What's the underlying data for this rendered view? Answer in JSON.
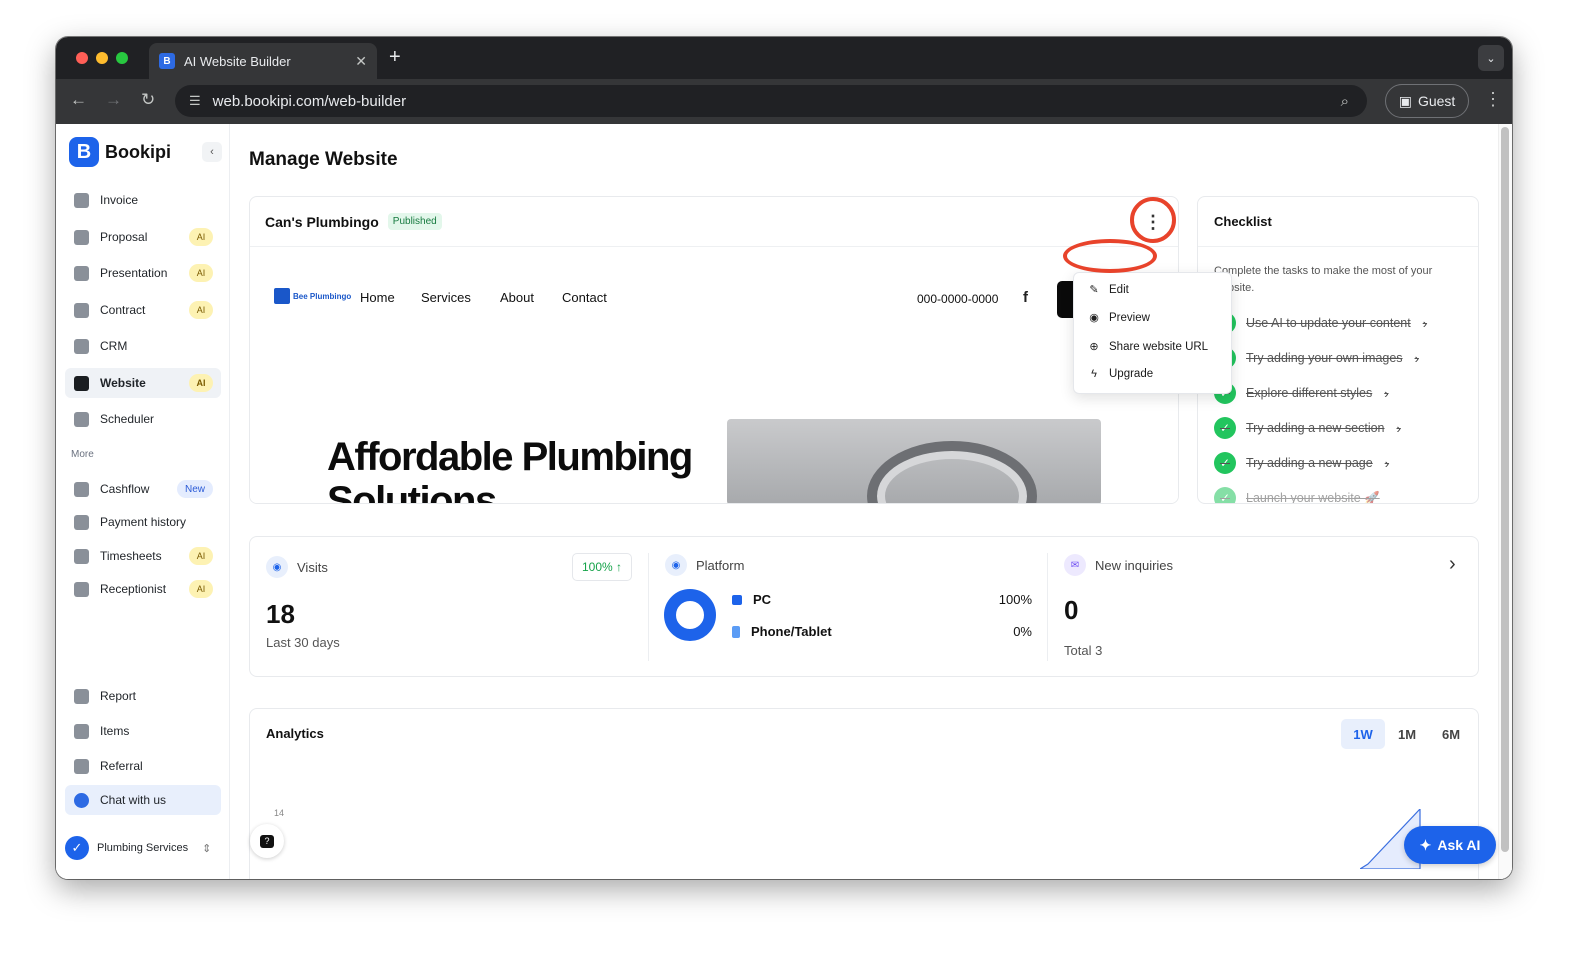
{
  "browser": {
    "tab_title": "AI Website Builder",
    "favicon_letter": "B",
    "tab_close": "✕",
    "new_tab": "+",
    "url": "web.bookipi.com/web-builder",
    "profile_label": "Guest"
  },
  "sidebar": {
    "brand": "Bookipi",
    "items": [
      {
        "label": "Invoice"
      },
      {
        "label": "Proposal",
        "badge": "AI"
      },
      {
        "label": "Presentation",
        "badge": "AI"
      },
      {
        "label": "Contract",
        "badge": "AI"
      },
      {
        "label": "CRM"
      },
      {
        "label": "Website",
        "badge": "AI"
      },
      {
        "label": "Scheduler"
      }
    ],
    "more_label": "More",
    "more_items": [
      {
        "label": "Cashflow",
        "badge": "New"
      },
      {
        "label": "Payment history"
      },
      {
        "label": "Timesheets",
        "badge": "AI"
      },
      {
        "label": "Receptionist",
        "badge": "AI"
      }
    ],
    "bottom_items": [
      {
        "label": "Report"
      },
      {
        "label": "Items"
      },
      {
        "label": "Referral"
      },
      {
        "label": "Chat with us"
      }
    ],
    "workspace": "Plumbing Services"
  },
  "main": {
    "page_title": "Manage Website",
    "site": {
      "name": "Can's Plumbingo",
      "status": "Published",
      "preview": {
        "logo_text": "Bee Plumbingo",
        "nav": [
          "Home",
          "Services",
          "About",
          "Contact"
        ],
        "phone": "000-0000-0000",
        "facebook_glyph": "f",
        "hero": "Affordable Plumbing Solutions"
      }
    },
    "menu": {
      "items": [
        {
          "label": "Edit",
          "icon": "pencil-icon",
          "glyph": "✎"
        },
        {
          "label": "Preview",
          "icon": "eye-icon",
          "glyph": "◉"
        },
        {
          "label": "Share website URL",
          "icon": "globe-icon",
          "glyph": "⊕"
        },
        {
          "label": "Upgrade",
          "icon": "bolt-icon",
          "glyph": "ϟ"
        }
      ]
    },
    "checklist": {
      "title": "Checklist",
      "description": "Complete the tasks to make the most of your website.",
      "tasks": [
        {
          "label": "Use AI to update your content",
          "done": true
        },
        {
          "label": "Try adding your own images",
          "done": true
        },
        {
          "label": "Explore different styles",
          "done": true
        },
        {
          "label": "Try adding a new section",
          "done": true
        },
        {
          "label": "Try adding a new page",
          "done": true
        },
        {
          "label": "Launch your website 🚀",
          "done": true
        }
      ]
    },
    "stats": {
      "visits": {
        "label": "Visits",
        "value": "18",
        "sub": "Last 30 days",
        "change": "100% ↑"
      },
      "platform": {
        "label": "Platform",
        "pc_share": 1.0,
        "rows": [
          {
            "name": "PC",
            "value": "100%",
            "color": "#1d63ea"
          },
          {
            "name": "Phone/Tablet",
            "value": "0%",
            "color": "#5b9cf5"
          }
        ]
      },
      "inquiries": {
        "label": "New inquiries",
        "value": "0",
        "sub": "Total 3",
        "arrow": "›"
      }
    },
    "analytics": {
      "title": "Analytics",
      "ranges": [
        "1W",
        "1M",
        "6M"
      ],
      "active_range": "1W",
      "y_tick": "14"
    },
    "ask_ai": "Ask AI"
  },
  "colors": {
    "accent": "#1d63ea",
    "success": "#22c55e",
    "annotation": "#e8432b"
  }
}
